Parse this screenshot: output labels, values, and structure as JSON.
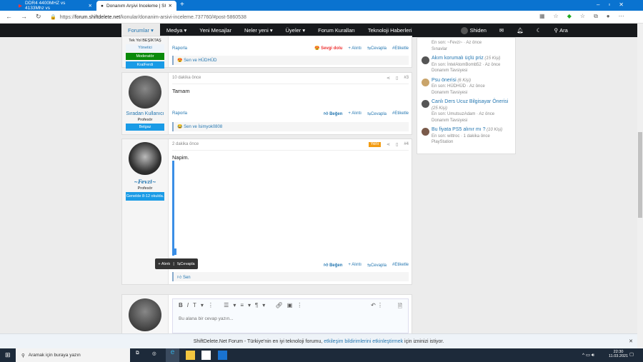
{
  "browser": {
    "tabs": [
      {
        "label": "DDR4 4400MHZ vs 4133Mhz vs"
      },
      {
        "label": "Donanım Arşivi İnceleme | ShiftD"
      }
    ],
    "url_prefix": "https://",
    "url_domain": "forum.shiftdelete.net",
    "url_path": "/konular/donanim-arsivi-inceleme.737760/#post-5860538"
  },
  "nav": {
    "items": [
      "Forumlar",
      "Medya",
      "Yeni Mesajlar",
      "Neler yeni",
      "Üyeler",
      "Forum Kuralları",
      "Teknoloji Haberleri"
    ],
    "user": "Shiden",
    "search": "Ara"
  },
  "post1": {
    "user_title": "Tek Yol BEŞİKTAŞ",
    "badges": [
      "Yönetici",
      "Moderatör",
      "KralFerdi"
    ],
    "report": "Raporla",
    "reaction": "Sevgi dolu",
    "quote": "+ Alıntı",
    "reply": "Cevapla",
    "tag": "#Etiketle",
    "reactions": "Sen ve HÜDHÜD"
  },
  "post2": {
    "time": "10 dakika önce",
    "num": "#3",
    "content": "Tamam",
    "username": "Sıradan Kullanıcı",
    "rank": "Profesör",
    "banner": "Belgaz",
    "report": "Raporla",
    "like": "Beğen",
    "quote": "+ Alıntı",
    "reply": "Cevapla",
    "tag": "#Etiketle",
    "reactions": "Sen ve İsimyok0808"
  },
  "post3": {
    "time": "2 dakika önce",
    "new": "Yeni",
    "num": "#4",
    "content": "Napim.",
    "username": "~Fevzi~",
    "rank": "Profesör",
    "banner": "Genelde 8-12 okulda.",
    "like": "Beğen",
    "quote": "+ Alıntı",
    "reply": "Cevapla",
    "tag": "#Etiketle",
    "reactions": "Sen"
  },
  "tooltip": {
    "quote": "+ Alıntı",
    "reply": "Cevapla"
  },
  "editor": {
    "placeholder": "Bu alana bir cevap yazın..."
  },
  "sidebar": {
    "items": [
      {
        "title": "",
        "count": "",
        "last": "En son: ~Fevzi~ · Az önce",
        "forum": "Sınavlar"
      },
      {
        "title": "Akım korumalı üçlü priz",
        "count": "(15 Kişi)",
        "last": "En son: İntelAtomBomb52 · Az önce",
        "forum": "Donanım Tavsiyesi"
      },
      {
        "title": "Psu önerisi",
        "count": "(6 Kişi)",
        "last": "En son: HÜDHÜD · Az önce",
        "forum": "Donanım Tavsiyesi"
      },
      {
        "title": "Canlı Ders Ucuz Bilgisayar Önerisi",
        "count": "(25 Kişi)",
        "last": "En son: UmutsuzAdam · Az önce",
        "forum": "Donanım Tavsiyesi"
      },
      {
        "title": "Bu fiyata PS5 alınır mı ?",
        "count": "(10 Kişi)",
        "last": "En son: wittroc · 1 dakika önce",
        "forum": "PlayStation"
      }
    ]
  },
  "notification": {
    "text": "ShiftDelete.Net Forum - Türkiye'nin en iyi teknoloji forumu, ",
    "link": "etkileşim bildirimlerini etkinleştirmek",
    "suffix": " için izninizi istiyor."
  },
  "taskbar": {
    "search": "Aramak için buraya yazın",
    "time": "22:30",
    "date": "11.03.2021"
  }
}
